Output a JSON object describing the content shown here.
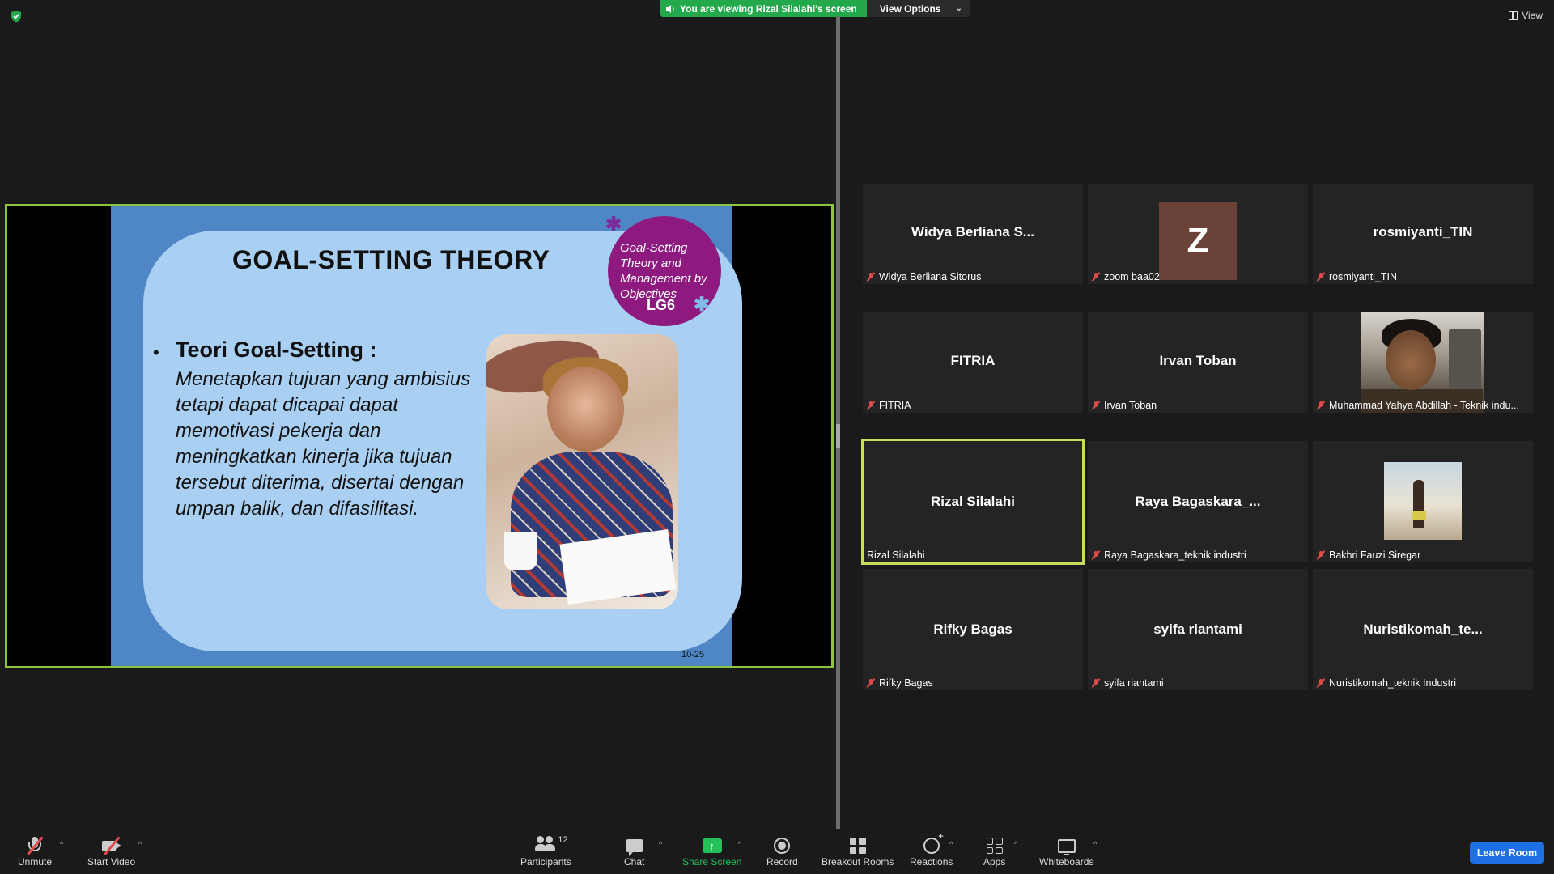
{
  "top": {
    "viewing_banner": "You are viewing Rizal Silalahi's screen",
    "view_options": "View Options",
    "view_button": "View"
  },
  "shared_slide": {
    "title": "GOAL-SETTING THEORY",
    "circle_text": "Goal-Setting Theory and Management by Objectives",
    "circle_code": "LG6",
    "bullet_heading": "Teori Goal-Setting :",
    "bullet_body": "Menetapkan tujuan yang ambisius tetapi dapat dicapai dapat memotivasi pekerja dan meningkatkan kinerja jika tujuan tersebut diterima, disertai dengan umpan balik, dan difasilitasi.",
    "slide_number": "10-25"
  },
  "participants": [
    {
      "display": "Widya Berliana S...",
      "label": "Widya Berliana Sitorus",
      "muted": true
    },
    {
      "display": "Z",
      "label": "zoom baa02",
      "muted": true
    },
    {
      "display": "rosmiyanti_TIN",
      "label": "rosmiyanti_TIN",
      "muted": true
    },
    {
      "display": "FITRIA",
      "label": "FITRIA",
      "muted": true
    },
    {
      "display": "Irvan Toban",
      "label": "Irvan Toban",
      "muted": true
    },
    {
      "display": "",
      "label": "Muhammad Yahya Abdillah - Teknik indu...",
      "muted": true
    },
    {
      "display": "Rizal Silalahi",
      "label": "Rizal Silalahi",
      "muted": false
    },
    {
      "display": "Raya  Bagaskara_...",
      "label": "Raya Bagaskara_teknik industri",
      "muted": true
    },
    {
      "display": "",
      "label": "Bakhri Fauzi Siregar",
      "muted": true
    },
    {
      "display": "Rifky Bagas",
      "label": "Rifky Bagas",
      "muted": true
    },
    {
      "display": "syifa riantami",
      "label": "syifa riantami",
      "muted": true
    },
    {
      "display": "Nuristikomah_te...",
      "label": "Nuristikomah_teknik Industri",
      "muted": true
    }
  ],
  "toolbar": {
    "unmute": "Unmute",
    "start_video": "Start Video",
    "participants": "Participants",
    "participant_count": "12",
    "chat": "Chat",
    "share_screen": "Share Screen",
    "record": "Record",
    "breakout_rooms": "Breakout Rooms",
    "reactions": "Reactions",
    "apps": "Apps",
    "whiteboards": "Whiteboards",
    "leave_room": "Leave Room"
  },
  "colors": {
    "share_green": "#23a84b",
    "active_speaker_border": "#c8dc5a",
    "share_border": "#8cc63f",
    "leave_blue": "#1f6fe5",
    "muted_red": "#e04b4b"
  }
}
